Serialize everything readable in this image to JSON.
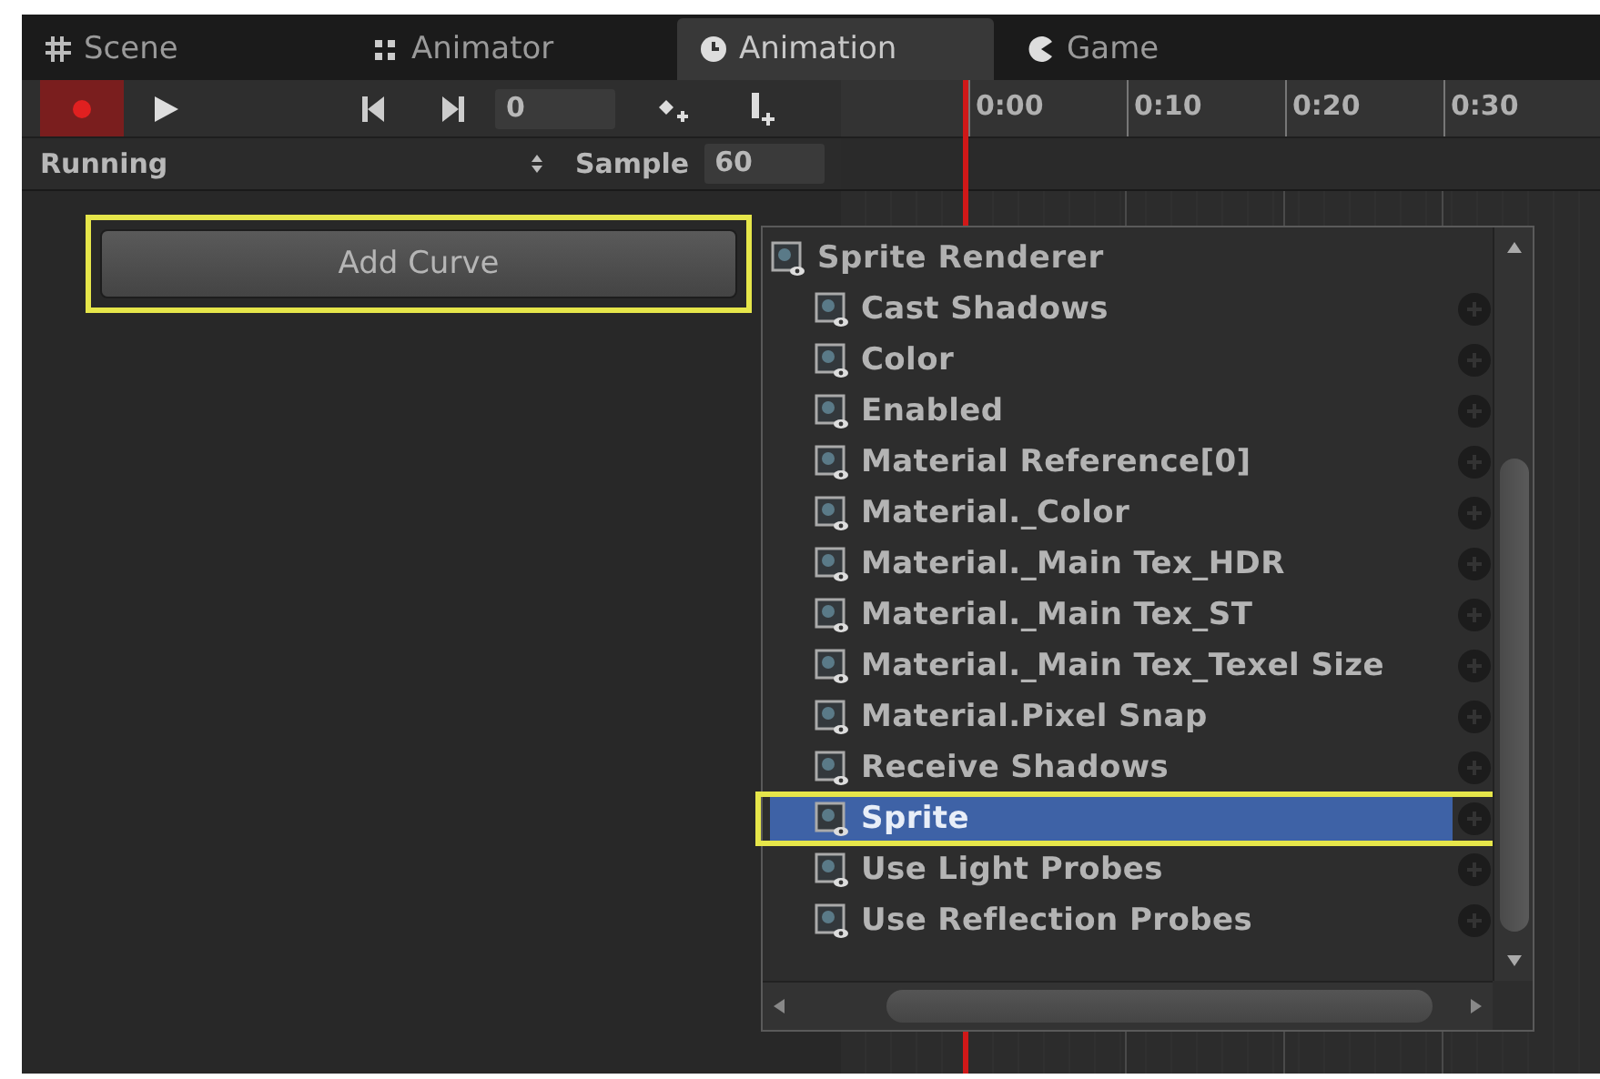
{
  "tabs": [
    {
      "label": "Scene",
      "selected": false
    },
    {
      "label": "Animator",
      "selected": false
    },
    {
      "label": "Animation",
      "selected": true
    },
    {
      "label": "Game",
      "selected": false
    }
  ],
  "toolbar": {
    "record_on": true,
    "frame": "0",
    "clip": "Running",
    "sample_label": "Sample",
    "sample_value": "60"
  },
  "timeline": {
    "ticks": [
      "0:00",
      "0:10",
      "0:20",
      "0:30"
    ]
  },
  "add_curve": {
    "label": "Add Curve",
    "highlighted": true
  },
  "popup": {
    "header": "Sprite Renderer",
    "items": [
      {
        "label": "Cast Shadows",
        "selected": false,
        "highlighted": false
      },
      {
        "label": "Color",
        "selected": false,
        "highlighted": false
      },
      {
        "label": "Enabled",
        "selected": false,
        "highlighted": false
      },
      {
        "label": "Material Reference[0]",
        "selected": false,
        "highlighted": false
      },
      {
        "label": "Material._Color",
        "selected": false,
        "highlighted": false
      },
      {
        "label": "Material._Main Tex_HDR",
        "selected": false,
        "highlighted": false
      },
      {
        "label": "Material._Main Tex_ST",
        "selected": false,
        "highlighted": false
      },
      {
        "label": "Material._Main Tex_Texel Size",
        "selected": false,
        "highlighted": false
      },
      {
        "label": "Material.Pixel Snap",
        "selected": false,
        "highlighted": false
      },
      {
        "label": "Receive Shadows",
        "selected": false,
        "highlighted": false
      },
      {
        "label": "Sprite",
        "selected": true,
        "highlighted": true
      },
      {
        "label": "Use Light Probes",
        "selected": false,
        "highlighted": false
      },
      {
        "label": "Use Reflection Probes",
        "selected": false,
        "highlighted": false
      }
    ]
  }
}
